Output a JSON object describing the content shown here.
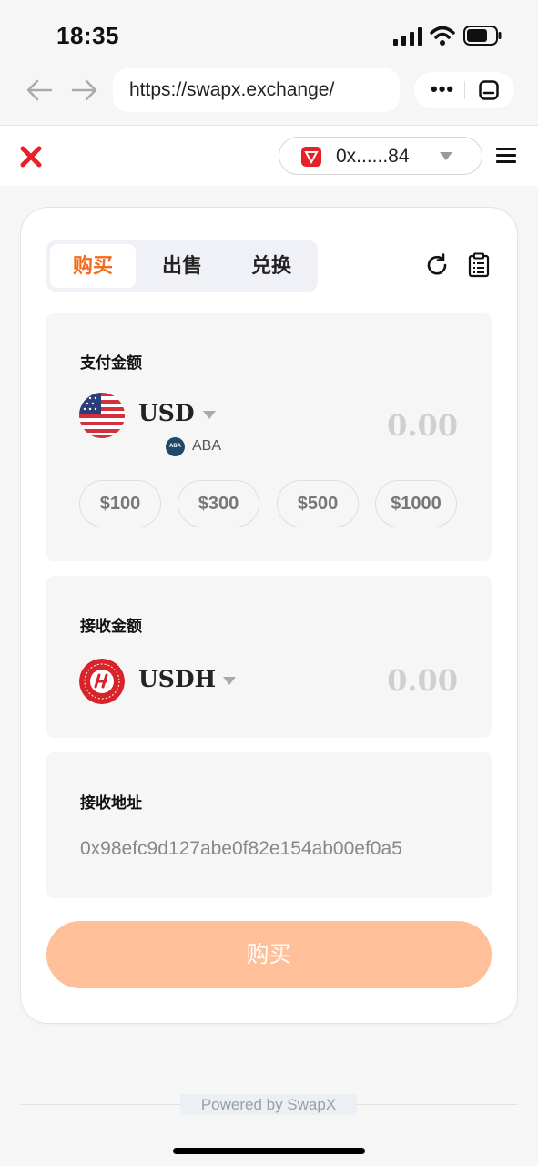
{
  "status_bar": {
    "time": "18:35"
  },
  "browser": {
    "url": "https://swapx.exchange/",
    "menu_dots": "•••"
  },
  "header": {
    "wallet_address": "0x......84"
  },
  "tabs": [
    {
      "label": "购买",
      "active": true
    },
    {
      "label": "出售",
      "active": false
    },
    {
      "label": "兑换",
      "active": false
    }
  ],
  "pay": {
    "label": "支付金额",
    "currency": "USD",
    "amount": "0.00",
    "bank": "ABA",
    "bank_icon_text": "ABA",
    "presets": [
      "$100",
      "$300",
      "$500",
      "$1000"
    ]
  },
  "receive": {
    "label": "接收金额",
    "currency": "USDH",
    "amount": "0.00"
  },
  "address": {
    "label": "接收地址",
    "value": "0x98efc9d127abe0f82e154ab00ef0a5"
  },
  "buy_button": "购买",
  "footer": "Powered by SwapX",
  "colors": {
    "accent": "#f26d1f",
    "button_disabled": "#ffbf99",
    "logo_red": "#e8202a"
  },
  "icons": [
    "back-arrow-icon",
    "forward-arrow-icon",
    "tabs-icon",
    "refresh-icon",
    "clipboard-icon",
    "hamburger-icon",
    "us-flag-icon",
    "usdh-coin-icon"
  ]
}
